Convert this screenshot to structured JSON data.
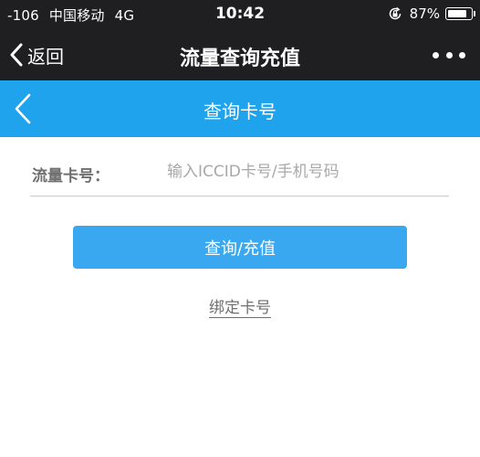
{
  "status_bar": {
    "signal": "-106",
    "carrier": "中国移动",
    "network": "4G",
    "time": "10:42",
    "battery_text": "87%",
    "battery_level": 0.87
  },
  "nav_bar": {
    "back_label": "返回",
    "title": "流量查询充值"
  },
  "page_header": {
    "title": "查询卡号"
  },
  "form": {
    "card_label": "流量卡号：",
    "card_placeholder": "输入ICCID卡号/手机号码",
    "submit_label": "查询/充值",
    "bind_link_label": "绑定卡号"
  },
  "colors": {
    "status_bg": "#1f1f21",
    "header_blue": "#1fa3ec",
    "button_blue": "#3aa8f0",
    "label_gray": "#6f6f6f"
  },
  "icons": [
    "lock-rotation-icon",
    "battery-icon",
    "back-chevron-icon",
    "more-icon",
    "header-back-icon"
  ]
}
